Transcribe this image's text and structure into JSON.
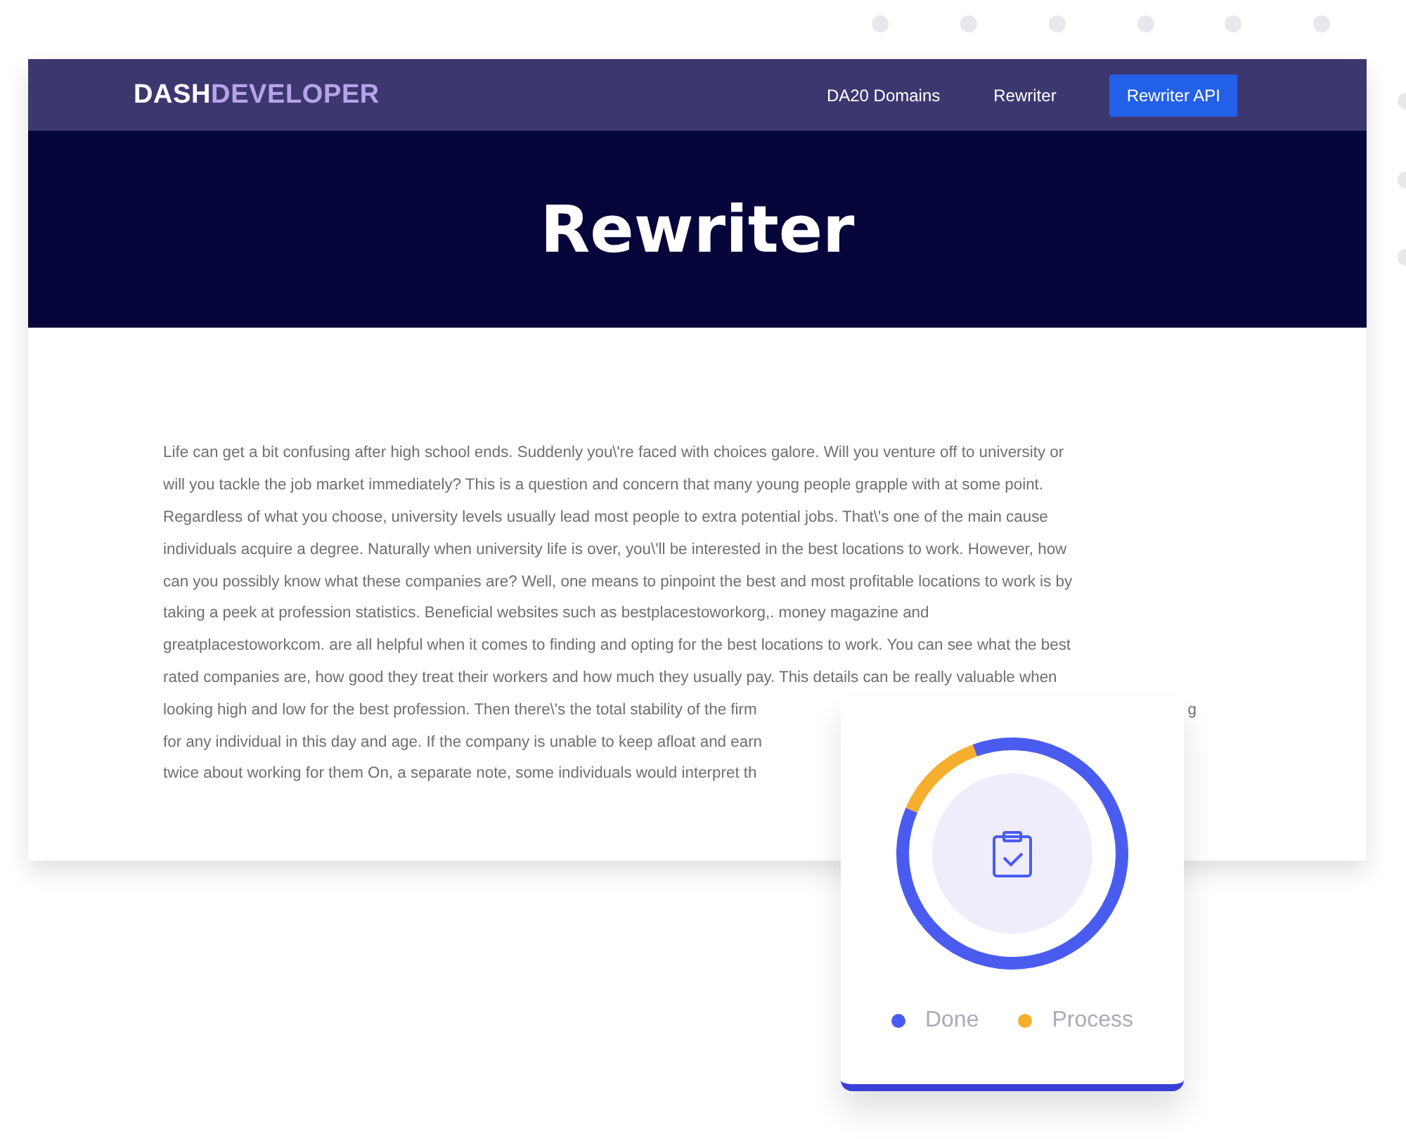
{
  "navbar": {
    "brand": [
      {
        "text": "DASH",
        "kind": "primary"
      },
      {
        "text": "DEVELOPER",
        "kind": "accent"
      }
    ],
    "links": [
      {
        "label": "DA20 Domains",
        "kind": "link"
      },
      {
        "label": "Rewriter",
        "kind": "link"
      },
      {
        "label": "Rewriter API",
        "kind": "button"
      }
    ]
  },
  "hero": {
    "title": "Rewriter"
  },
  "article": {
    "lines": [
      {
        "text": "Life can get a bit confusing after high school ends. Suddenly you\\'re faced with choices galore. Will you venture off to university or"
      },
      {
        "text": "will you tackle the job market immediately? This is a question and concern that many young people grapple with at some point."
      },
      {
        "text": "Regardless of what you choose, university levels usually lead most people to extra potential jobs. That\\'s one of the main cause"
      },
      {
        "text": "individuals acquire a degree. Naturally when university life is over, you\\'ll be interested in the best locations to work. However, how"
      },
      {
        "text": "can you possibly know what these companies are? Well, one means to pinpoint the best and most profitable locations to work is by"
      },
      {
        "text": "taking a peek at profession statistics. Beneficial websites such as bestplacestoworkorg,. money magazine and"
      },
      {
        "text": "greatplacestoworkcom. are all helpful when it comes to finding and opting for the best locations to work. You can see what the best"
      },
      {
        "text": "rated companies are, how good they treat their workers and how much they usually pay. This details can be really valuable when"
      },
      {
        "text": "looking high and low for the best profession. Then there\\'s the total stability of the firm",
        "end": "g"
      },
      {
        "text": "for any individual in this day and age. If the company is unable to keep afloat and earn"
      },
      {
        "text": "twice about working for them On, a separate note, some individuals would interpret th"
      }
    ]
  },
  "status_card": {
    "level": 0.87,
    "legend": [
      {
        "label": "Done",
        "color": "#4a5cf0"
      },
      {
        "label": "Process",
        "color": "#f5ae2e"
      }
    ]
  }
}
